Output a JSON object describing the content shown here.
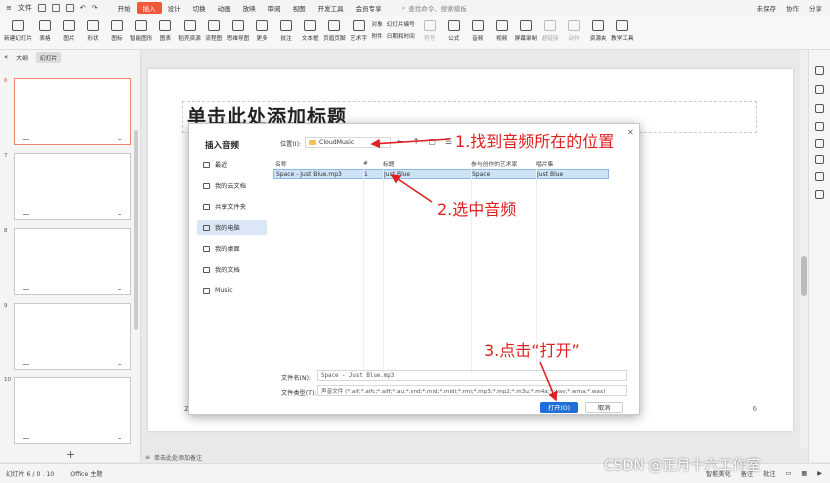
{
  "menubar": {
    "file_label": "文件",
    "tabs": [
      "开始",
      "插入",
      "设计",
      "切换",
      "动画",
      "放映",
      "审阅",
      "视图",
      "开发工具",
      "会员专享"
    ],
    "active_tab": "插入",
    "search_placeholder": "查找命令、搜索模板",
    "right_items": [
      "未保存",
      "协作",
      "分享"
    ]
  },
  "ribbon": {
    "buttons": [
      "新建幻灯片",
      "表格",
      "图片",
      "形状",
      "图标",
      "智能图形",
      "图表",
      "稻壳资源",
      "流程图",
      "思维导图",
      "更多",
      "批注",
      "文本框",
      "页眉页脚",
      "艺术字"
    ],
    "col1": [
      "对象",
      "附件"
    ],
    "col2": [
      "幻灯片编号",
      "日期和时间"
    ],
    "buttons2": [
      "符号",
      "公式",
      "音频",
      "视频",
      "屏幕录制",
      "超链接",
      "动作",
      "资源夹",
      "教学工具"
    ]
  },
  "leftpanel": {
    "tabs": [
      "大纲",
      "幻灯片"
    ],
    "active_tab": "幻灯片",
    "slide_numbers": [
      "6",
      "7",
      "8",
      "9",
      "10"
    ]
  },
  "slide": {
    "title": "单击此处添加标题",
    "number": "6",
    "footer_num": "2"
  },
  "notes": {
    "placeholder": "单击此处添加备注"
  },
  "status": {
    "slide_info": "幻灯片 6 / 0 . 10",
    "theme": "Office 主题",
    "smart_beautify": "智能美化",
    "notes_btn": "备注",
    "comments_btn": "批注"
  },
  "watermark": "CSDN @正月十六工作室",
  "dialog": {
    "title": "插入音频",
    "nav": [
      "最近",
      "我的云文档",
      "共享文件夹",
      "我的电脑",
      "我的桌面",
      "我的文档",
      "Music"
    ],
    "active_nav": "我的电脑",
    "location_label": "位置(I):",
    "location_value": "CloudMusic",
    "columns": [
      "名称",
      "#",
      "标题",
      "参与创作的艺术家",
      "唱片集"
    ],
    "rows": [
      {
        "name": "Space - Just Blue.mp3",
        "num": "1",
        "title": "Just Blue",
        "artist": "Space",
        "album": "Just Blue"
      }
    ],
    "filename_label": "文件名(N):",
    "filename_value": "Space - Just Blue.mp3",
    "filetype_label": "文件类型(T):",
    "filetype_value": "声音文件 (*.aif;*.aifc;*.aiff;*.au;*.snd;*.mid;*.midi;*.rmi;*.mp3;*.mp2;*.m3u;*.m4a;*.wav;*.wma;*.wax)",
    "open_label": "打开(O)",
    "cancel_label": "取消"
  },
  "annotations": {
    "step1": "1.找到音频所在的位置",
    "step2": "2.选中音频",
    "step3": "3.点击“打开”",
    "color": "#e02020"
  }
}
